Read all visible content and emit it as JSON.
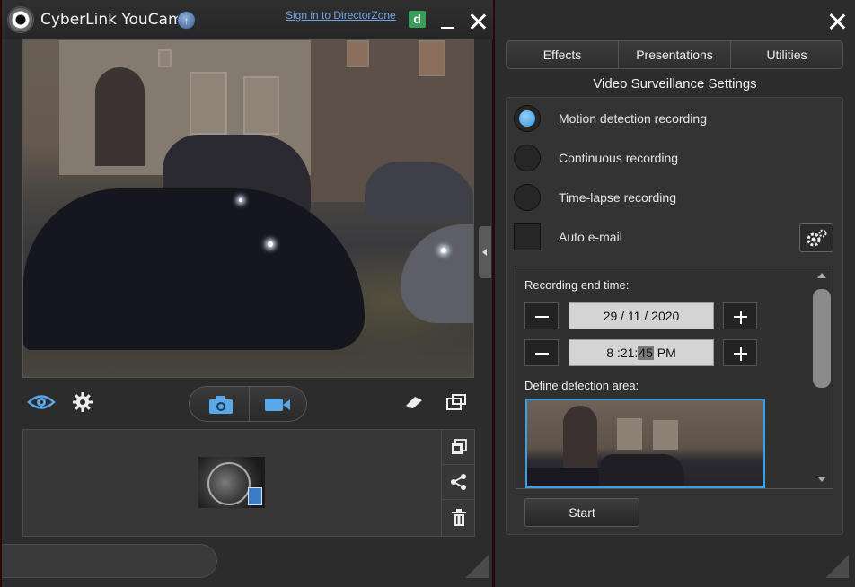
{
  "app": {
    "title": "CyberLink YouCam",
    "sign_in_link": "Sign in to DirectorZone",
    "directorzone_icon_letter": "d"
  },
  "icons": {
    "logo": "youcam-logo-icon",
    "upgrade": "upgrade-arrow-icon",
    "minimize": "minimize-icon",
    "close": "close-icon",
    "eye": "eye-icon",
    "settings": "gear-icon",
    "camera": "camera-icon",
    "video": "video-camera-icon",
    "eraser": "eraser-icon",
    "resize": "resize-window-icon",
    "gallery_import": "import-media-icon",
    "share": "share-icon",
    "delete": "trash-icon",
    "email_settings": "gear-settings-icon"
  },
  "colors": {
    "accent_blue": "#3aa0e8",
    "radio_selected": "#3c93d8",
    "link": "#6fa8e8"
  },
  "right_panel": {
    "tabs": [
      "Effects",
      "Presentations",
      "Utilities"
    ],
    "title": "Video Surveillance Settings",
    "options": [
      {
        "label": "Motion detection recording",
        "selected": true
      },
      {
        "label": "Continuous recording",
        "selected": false
      },
      {
        "label": "Time-lapse recording",
        "selected": false
      }
    ],
    "auto_email": {
      "label": "Auto e-mail",
      "checked": false
    },
    "recording_end_time": {
      "label": "Recording end time:",
      "date": {
        "day": "29",
        "month": "11",
        "year": "2020",
        "sep": "/"
      },
      "time": {
        "hour": "8",
        "minute": "21",
        "second": "45",
        "ampm": "PM",
        "sep": ":"
      }
    },
    "detection_area_label": "Define detection area:",
    "start_button": "Start"
  }
}
